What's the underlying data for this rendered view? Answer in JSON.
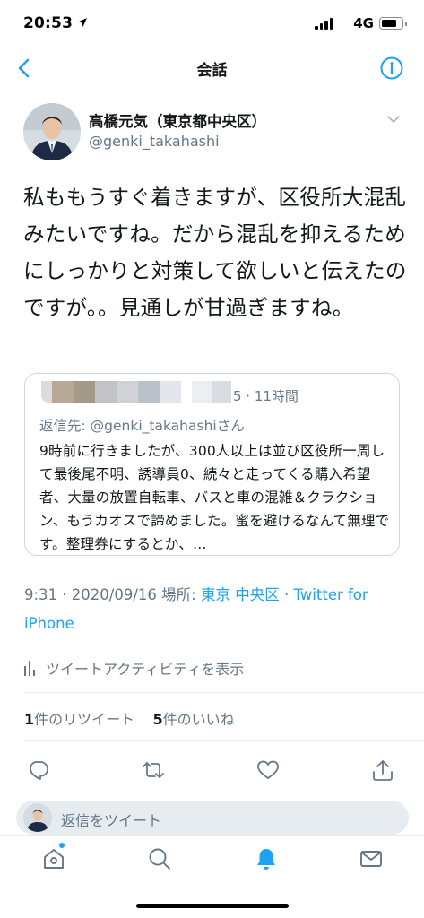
{
  "status_bar": {
    "time": "20:53",
    "network": "4G"
  },
  "header": {
    "title": "会話",
    "back_icon": "chevron-left-icon",
    "info_icon": "info-icon"
  },
  "tweet": {
    "author_name": "高橋元気（東京都中央区）",
    "author_handle": "@genki_takahashi",
    "text": "私ももうすぐ着きますが、区役所大混乱みたいですね。だから混乱を抑えるためにしっかりと対策して欲しいと伝えたのですが。。見通しが甘過ぎますね。",
    "timestamp": "9:31 · 2020/09/16",
    "location_label": "場所:",
    "location": "東京 中央区",
    "separator": "·",
    "client": "Twitter for iPhone"
  },
  "quoted_reply": {
    "time_suffix": "5 · 11時間",
    "replying_label": "返信先:",
    "replying_handle": "@genki_takahashiさん",
    "body": "9時前に行きましたが、300人以上は並び区役所一周して最後尾不明、誘導員0、続々と走ってくる購入希望者、大量の放置自転車、バスと車の混雑＆クラクション、もうカオスで諦めました。蜜を避けるなんて無理です。整理券にするとか、…"
  },
  "activity": {
    "label": "ツイートアクティビティを表示",
    "icon": "bar-chart-icon"
  },
  "stats": {
    "retweet_count": "1",
    "retweet_label": "件のリツイート",
    "like_count": "5",
    "like_label": "件のいいね"
  },
  "actions": [
    "reply-icon",
    "retweet-icon",
    "like-icon",
    "share-icon"
  ],
  "reply_bar": {
    "placeholder": "返信をツイート"
  },
  "tab_bar": [
    "home-icon",
    "search-icon",
    "notifications-icon",
    "messages-icon"
  ],
  "colors": {
    "accent": "#1da1f2",
    "secondary_text": "#657786",
    "border": "#e6ecf0"
  }
}
